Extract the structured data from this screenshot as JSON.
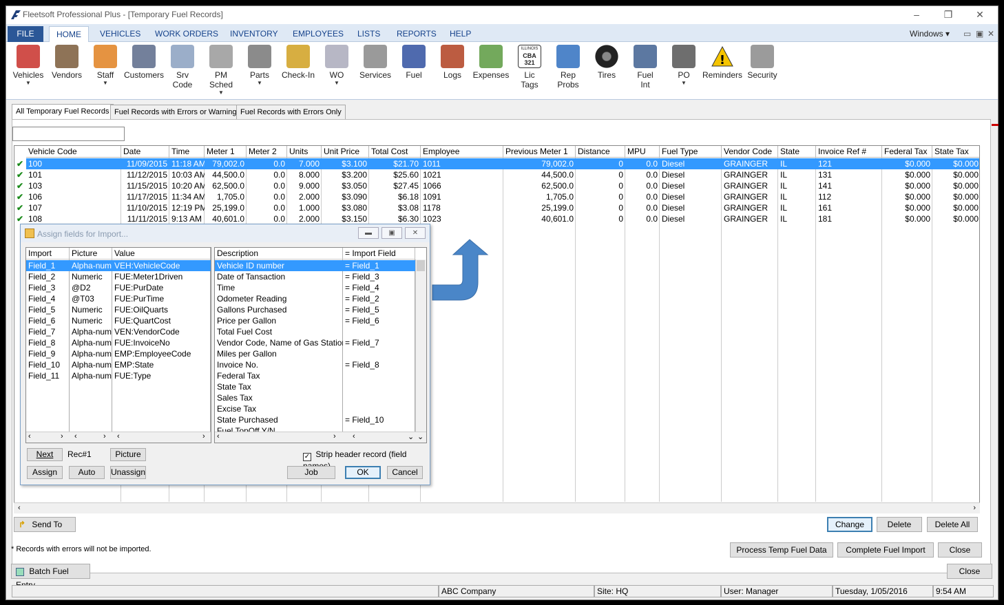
{
  "window": {
    "title": "Fleetsoft Professional Plus - [Temporary Fuel Records]"
  },
  "menu": {
    "file": "FILE",
    "tabs": [
      "HOME",
      "VEHICLES",
      "WORK ORDERS",
      "INVENTORY",
      "EMPLOYEES",
      "LISTS",
      "REPORTS",
      "HELP"
    ],
    "windows": "Windows"
  },
  "ribbon": [
    {
      "label": "Vehicles",
      "icon": "truck-icon",
      "dropdown": true
    },
    {
      "label": "Vendors",
      "icon": "vendors-icon",
      "dropdown": false
    },
    {
      "label": "Staff",
      "icon": "staff-icon",
      "dropdown": true
    },
    {
      "label": "Customers",
      "icon": "customers-icon",
      "dropdown": false
    },
    {
      "label": "Srv\nCode",
      "icon": "srv-code-icon",
      "dropdown": false
    },
    {
      "label": "PM\nSched",
      "icon": "stopwatch-icon",
      "dropdown": true
    },
    {
      "label": "Parts",
      "icon": "parts-icon",
      "dropdown": true
    },
    {
      "label": "Check-In",
      "icon": "check-in-icon",
      "dropdown": false
    },
    {
      "label": "WO",
      "icon": "wo-icon",
      "dropdown": true
    },
    {
      "label": "Services",
      "icon": "wrench-icon",
      "dropdown": false
    },
    {
      "label": "Fuel",
      "icon": "fuel-pump-icon",
      "dropdown": false
    },
    {
      "label": "Logs",
      "icon": "logs-icon",
      "dropdown": false
    },
    {
      "label": "Expenses",
      "icon": "money-icon",
      "dropdown": false
    },
    {
      "label": "Lic\nTags",
      "icon": "license-tag-icon",
      "dropdown": false
    },
    {
      "label": "Rep\nProbs",
      "icon": "warning-chart-icon",
      "dropdown": false
    },
    {
      "label": "Tires",
      "icon": "tire-icon",
      "dropdown": false
    },
    {
      "label": "Fuel\nInt",
      "icon": "fuel-int-icon",
      "dropdown": false
    },
    {
      "label": "PO",
      "icon": "po-icon",
      "dropdown": true
    },
    {
      "label": "Reminders",
      "icon": "warning-icon",
      "dropdown": false
    },
    {
      "label": "Security",
      "icon": "lock-icon",
      "dropdown": false
    }
  ],
  "ribbon_text": {
    "tag_text": "CBA 321",
    "tag_state": "ILLINOIS"
  },
  "page_tabs": [
    "All Temporary Fuel Records",
    "Fuel Records with Errors or Warnings",
    "Fuel Records with Errors Only"
  ],
  "grid": {
    "columns": [
      "Vehicle Code",
      "Date",
      "Time",
      "Meter 1",
      "Meter 2",
      "Units",
      "Unit Price",
      "Total Cost",
      "Employee",
      "Previous Meter 1",
      "Distance",
      "MPU",
      "Fuel Type",
      "Vendor Code",
      "State",
      "Invoice Ref #",
      "Federal Tax",
      "State Tax"
    ],
    "rows": [
      [
        "100",
        "11/09/2015",
        "11:18 AM",
        "79,002.0",
        "0.0",
        "7.000",
        "$3.100",
        "$21.70",
        "1011",
        "79,002.0",
        "0",
        "0.0",
        "Diesel",
        "GRAINGER",
        "IL",
        "121",
        "$0.000",
        "$0.000"
      ],
      [
        "101",
        "11/12/2015",
        "10:03 AM",
        "44,500.0",
        "0.0",
        "8.000",
        "$3.200",
        "$25.60",
        "1021",
        "44,500.0",
        "0",
        "0.0",
        "Diesel",
        "GRAINGER",
        "IL",
        "131",
        "$0.000",
        "$0.000"
      ],
      [
        "103",
        "11/15/2015",
        "10:20 AM",
        "62,500.0",
        "0.0",
        "9.000",
        "$3.050",
        "$27.45",
        "1066",
        "62,500.0",
        "0",
        "0.0",
        "Diesel",
        "GRAINGER",
        "IL",
        "141",
        "$0.000",
        "$0.000"
      ],
      [
        "106",
        "11/17/2015",
        "11:34 AM",
        "1,705.0",
        "0.0",
        "2.000",
        "$3.090",
        "$6.18",
        "1091",
        "1,705.0",
        "0",
        "0.0",
        "Diesel",
        "GRAINGER",
        "IL",
        "112",
        "$0.000",
        "$0.000"
      ],
      [
        "107",
        "11/10/2015",
        "12:19 PM",
        "25,199.0",
        "0.0",
        "1.000",
        "$3.080",
        "$3.08",
        "1178",
        "25,199.0",
        "0",
        "0.0",
        "Diesel",
        "GRAINGER",
        "IL",
        "161",
        "$0.000",
        "$0.000"
      ],
      [
        "108",
        "11/11/2015",
        "9:13 AM",
        "40,601.0",
        "0.0",
        "2.000",
        "$3.150",
        "$6.30",
        "1023",
        "40,601.0",
        "0",
        "0.0",
        "Diesel",
        "GRAINGER",
        "IL",
        "181",
        "$0.000",
        "$0.000"
      ]
    ],
    "selected_row": 0
  },
  "dialog": {
    "title": "Assign fields for Import...",
    "left_headers": [
      "Import Field",
      "Picture",
      "Value"
    ],
    "left_rows": [
      [
        "Field_1",
        "Alpha-num",
        "VEH:VehicleCode"
      ],
      [
        "Field_2",
        "Numeric",
        "FUE:Meter1Driven"
      ],
      [
        "Field_3",
        "@D2",
        "FUE:PurDate"
      ],
      [
        "Field_4",
        "@T03",
        "FUE:PurTime"
      ],
      [
        "Field_5",
        "Numeric",
        "FUE:OilQuarts"
      ],
      [
        "Field_6",
        "Numeric",
        "FUE:QuartCost"
      ],
      [
        "Field_7",
        "Alpha-num",
        "VEN:VendorCode"
      ],
      [
        "Field_8",
        "Alpha-num",
        "FUE:InvoiceNo"
      ],
      [
        "Field_9",
        "Alpha-num",
        "EMP:EmployeeCode"
      ],
      [
        "Field_10",
        "Alpha-num",
        "EMP:State"
      ],
      [
        "Field_11",
        "Alpha-num",
        "FUE:Type"
      ]
    ],
    "right_headers": [
      "Description",
      "= Import Field"
    ],
    "right_rows": [
      [
        "Vehicle ID number",
        "= Field_1"
      ],
      [
        "Date of Tansaction",
        "= Field_3"
      ],
      [
        "Time",
        "= Field_4"
      ],
      [
        "Odometer Reading",
        "= Field_2"
      ],
      [
        "Gallons Purchased",
        "= Field_5"
      ],
      [
        "Price per Gallon",
        "= Field_6"
      ],
      [
        "Total Fuel Cost",
        ""
      ],
      [
        "Vendor Code, Name of Gas Station",
        "= Field_7"
      ],
      [
        "Miles per Gallon",
        ""
      ],
      [
        "Invoice No.",
        "= Field_8"
      ],
      [
        "Federal Tax",
        ""
      ],
      [
        "State Tax",
        ""
      ],
      [
        "Sales Tax",
        ""
      ],
      [
        "Excise Tax",
        ""
      ],
      [
        "State Purchased",
        "= Field_10"
      ],
      [
        "Fuel TopOff Y/N",
        ""
      ]
    ],
    "buttons": {
      "next": "Next",
      "rec": "Rec#1",
      "picture": "Picture",
      "assign": "Assign",
      "auto": "Auto",
      "unassign": "Unassign",
      "job": "Job",
      "ok": "OK",
      "cancel": "Cancel"
    },
    "strip_label": "Strip header record (field names)",
    "strip_checked": true
  },
  "actions": {
    "send_to": "Send To",
    "change": "Change",
    "delete": "Delete",
    "delete_all": "Delete All",
    "note": "* Records with errors will not be imported.",
    "process": "Process Temp Fuel Data",
    "complete": "Complete Fuel Import",
    "close": "Close",
    "batch": "Batch Fuel Entry",
    "close2": "Close"
  },
  "status": {
    "company": "ABC Company",
    "site": "Site: HQ",
    "user": "User: Manager",
    "date": "Tuesday,  1/05/2016",
    "time": "9:54 AM"
  },
  "colors": {
    "accent": "#2b5797",
    "selection": "#3399ff",
    "arrow": "#4a86c8"
  }
}
